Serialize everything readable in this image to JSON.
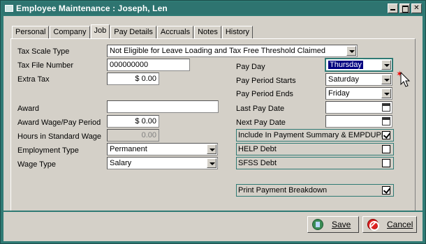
{
  "window": {
    "title": "Employee Maintenance : Joseph, Len"
  },
  "tabs": [
    {
      "label": "Personal",
      "active": false
    },
    {
      "label": "Company",
      "active": false
    },
    {
      "label": "Job",
      "active": true
    },
    {
      "label": "Pay Details",
      "active": false
    },
    {
      "label": "Accruals",
      "active": false
    },
    {
      "label": "Notes",
      "active": false
    },
    {
      "label": "History",
      "active": false
    }
  ],
  "left": {
    "tax_scale_type": {
      "label": "Tax Scale Type",
      "value": "Not Eligible for Leave Loading and Tax Free Threshold Claimed"
    },
    "tax_file_number": {
      "label": "Tax File Number",
      "value": "000000000"
    },
    "extra_tax": {
      "label": "Extra Tax",
      "value": "$ 0.00"
    },
    "award": {
      "label": "Award",
      "value": ""
    },
    "award_wage": {
      "label": "Award Wage/Pay Period",
      "value": "$ 0.00"
    },
    "hours_standard": {
      "label": "Hours in Standard Wage",
      "value": "0.00"
    },
    "employment_type": {
      "label": "Employment Type",
      "value": "Permanent"
    },
    "wage_type": {
      "label": "Wage Type",
      "value": "Salary"
    }
  },
  "right": {
    "pay_day": {
      "label": "Pay Day",
      "value": "Thursday"
    },
    "pay_period_starts": {
      "label": "Pay Period Starts",
      "value": "Saturday"
    },
    "pay_period_ends": {
      "label": "Pay Period Ends",
      "value": "Friday"
    },
    "last_pay_date": {
      "label": "Last Pay Date",
      "value": ""
    },
    "next_pay_date": {
      "label": "Next Pay Date",
      "value": ""
    },
    "include_payment_summary": {
      "label": "Include In Payment Summary & EMPDUPE",
      "checked": true
    },
    "help_debt": {
      "label": "HELP Debt",
      "checked": false
    },
    "sfss_debt": {
      "label": "SFSS Debt",
      "checked": false
    },
    "print_payment_breakdown": {
      "label": "Print Payment Breakdown",
      "checked": true
    }
  },
  "buttons": {
    "save": "Save",
    "cancel": "Cancel"
  },
  "icons": {
    "title": "app-icon",
    "save": "save-icon",
    "cancel": "cancel-icon",
    "calendar": "calendar-icon"
  },
  "colors": {
    "frame": "#2f7a74",
    "panel": "#d4d0c8",
    "selection": "#000080"
  }
}
